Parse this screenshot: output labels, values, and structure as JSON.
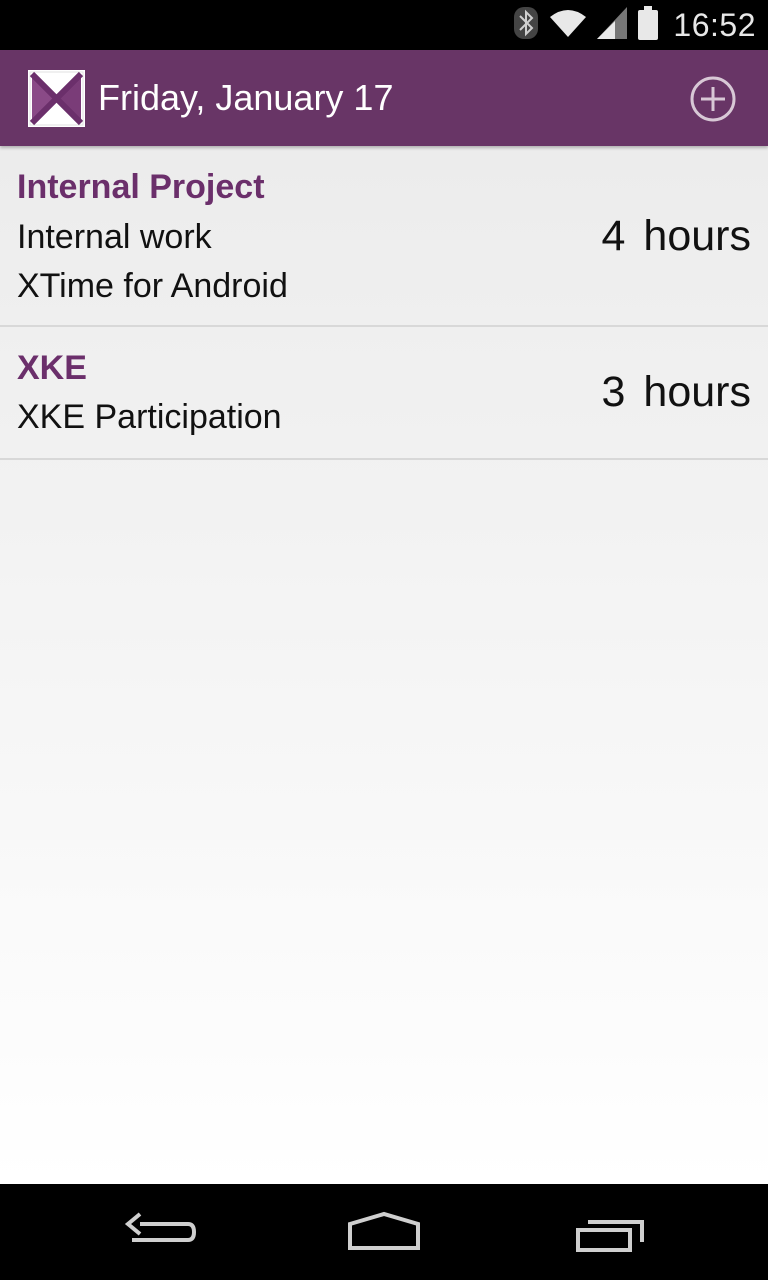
{
  "status_bar": {
    "time": "16:52",
    "icons": [
      "bluetooth-icon",
      "wifi-icon",
      "signal-icon",
      "battery-icon"
    ]
  },
  "action_bar": {
    "title": "Friday, January 17",
    "logo_icon": "app-logo-x-icon",
    "add_icon": "add-circle-icon",
    "color": "#683566"
  },
  "entries": [
    {
      "project": "Internal Project",
      "lines": [
        "Internal work",
        "XTime for Android"
      ],
      "hours_value": "4",
      "hours_unit": "hours"
    },
    {
      "project": "XKE",
      "lines": [
        "XKE Participation"
      ],
      "hours_value": "3",
      "hours_unit": "hours"
    }
  ],
  "nav_bar": {
    "icons": [
      "back-icon",
      "home-icon",
      "recent-apps-icon"
    ]
  },
  "colors": {
    "accent": "#683566",
    "project_text": "#6b2f6b"
  }
}
